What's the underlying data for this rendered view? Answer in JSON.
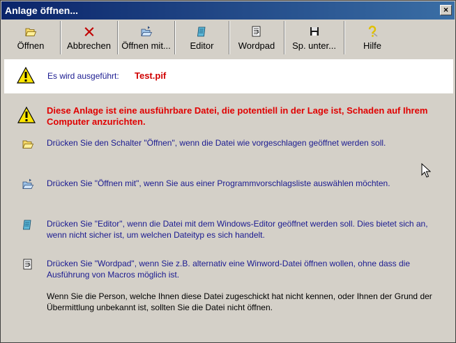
{
  "window": {
    "title": "Anlage öffnen...",
    "close_label": "×"
  },
  "toolbar": {
    "buttons": [
      {
        "label": "Öffnen",
        "icon": "folder-open-icon"
      },
      {
        "label": "Abbrechen",
        "icon": "x-icon"
      },
      {
        "label": "Öffnen mit...",
        "icon": "folder-open-with-icon"
      },
      {
        "label": "Editor",
        "icon": "notepad-icon"
      },
      {
        "label": "Wordpad",
        "icon": "wordpad-icon"
      },
      {
        "label": "Sp. unter...",
        "icon": "floppy-disk-icon"
      },
      {
        "label": "Hilfe",
        "icon": "help-icon"
      }
    ]
  },
  "banner": {
    "exec_label": "Es wird ausgeführt:",
    "filename": "Test.pif"
  },
  "warning": {
    "text": "Diese Anlage ist eine ausführbare Datei, die potentiell in der Lage ist, Schaden auf Ihrem Computer anzurichten."
  },
  "items": [
    {
      "text": "Drücken Sie den Schalter \"Öffnen\", wenn die Datei wie vorgeschlagen geöffnet werden soll."
    },
    {
      "text": "Drücken Sie \"Öffnen mit\", wenn Sie aus einer Programmvorschlagsliste auswählen möchten."
    },
    {
      "text": "Drücken Sie \"Editor\", wenn die Datei mit dem Windows-Editor geöffnet werden soll. Dies bietet sich an, wenn nicht sicher ist, um welchen Dateityp es sich handelt."
    },
    {
      "text": "Drücken Sie \"Wordpad\", wenn Sie z.B. alternativ eine Winword-Datei öffnen wollen, ohne dass die Ausführung von Macros möglich ist."
    }
  ],
  "final_text": "Wenn Sie die Person, welche Ihnen diese Datei zugeschickt hat nicht kennen, oder Ihnen der Grund der Übermittlung unbekannt ist, sollten Sie die Datei nicht öffnen.",
  "colors": {
    "title_start": "#0a246a",
    "title_end": "#3a6ea5",
    "text_blue": "#1a1a90",
    "text_red": "#e00000"
  }
}
